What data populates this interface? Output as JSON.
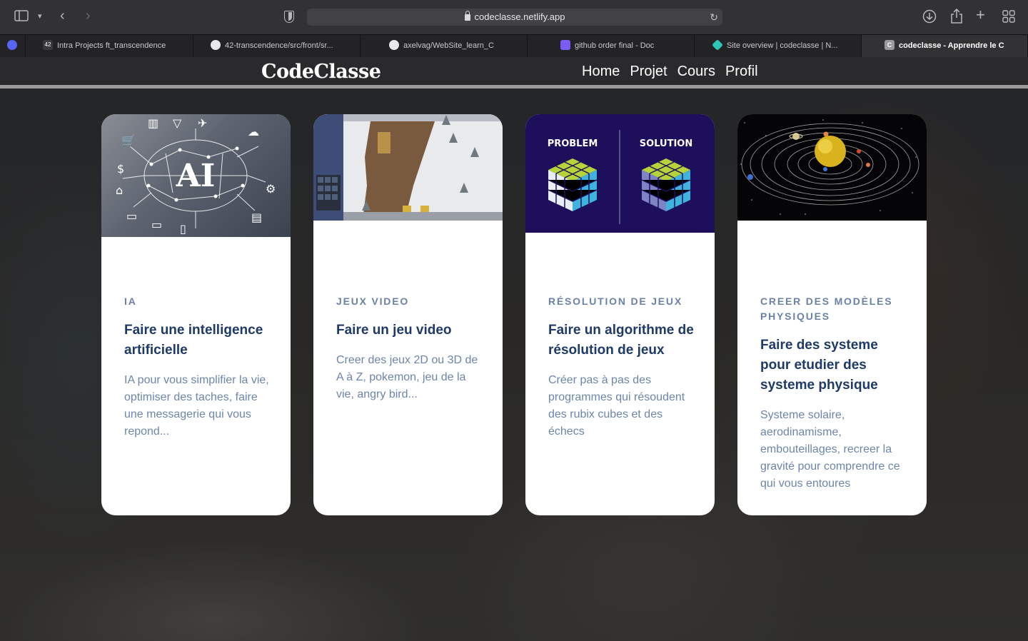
{
  "browser": {
    "url": "codeclasse.netlify.app",
    "tabs": [
      {
        "title": "",
        "favicon": "discord-icon",
        "color": "#5865f2"
      },
      {
        "title": "Intra Projects ft_transcendence",
        "favicon": "42-icon",
        "color": "#1d1d1f"
      },
      {
        "title": "42-transcendence/src/front/sr...",
        "favicon": "github-icon",
        "color": "#f0f0f0"
      },
      {
        "title": "axelvag/WebSite_learn_C",
        "favicon": "github-icon",
        "color": "#f0f0f0"
      },
      {
        "title": "github order final - Doc",
        "favicon": "doc-icon",
        "color": "#7b5cf5"
      },
      {
        "title": "Site overview | codeclasse | N...",
        "favicon": "netlify-icon",
        "color": "#2ec4b6"
      },
      {
        "title": "codeclasse - Apprendre le C",
        "favicon": "codeclasse-icon",
        "color": "#9a9a9e"
      }
    ]
  },
  "site": {
    "logo": "CodeClasse",
    "nav": [
      "Home",
      "Projet",
      "Cours",
      "Profil"
    ]
  },
  "cards": [
    {
      "category": "IA",
      "title": "Faire une intelligence artificielle",
      "description": "IA pour vous simplifier la vie, optimiser des taches, faire une messagerie qui vous repond...",
      "image_text": "AI"
    },
    {
      "category": "JEUX VIDEO",
      "title": "Faire un jeu video",
      "description": "Creer des jeux 2D ou 3D de A à Z, pokemon, jeu de la vie, angry bird..."
    },
    {
      "category": "RÉSOLUTION DE JEUX",
      "title": "Faire un algorithme de résolution de jeux",
      "description": "Créer pas à pas des programmes qui résoudent des rubix cubes et des échecs",
      "image_labels": [
        "PROBLEM",
        "SOLUTION"
      ]
    },
    {
      "category": "CREER DES MODÈLES PHYSIQUES",
      "title": "Faire des systeme pour etudier des systeme physique",
      "description": "Systeme solaire, aerodinamisme, embouteillages, recreer la gravité pour comprendre ce qui vous entoures"
    }
  ]
}
